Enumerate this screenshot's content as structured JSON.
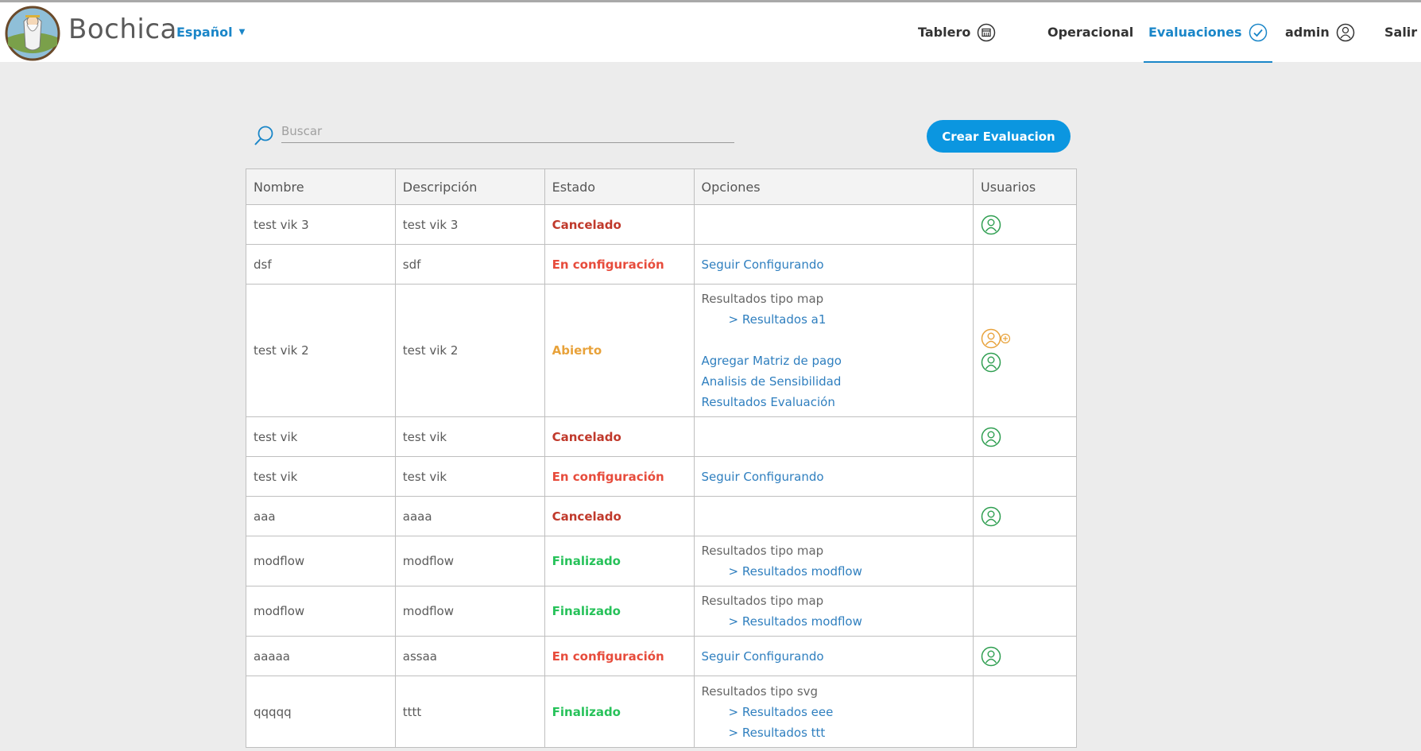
{
  "header": {
    "brand": "Bochica",
    "language": "Español",
    "nav": {
      "tablero": "Tablero",
      "operacional": "Operacional",
      "evaluaciones": "Evaluaciones",
      "admin": "admin",
      "salir": "Salir"
    }
  },
  "search": {
    "placeholder": "Buscar"
  },
  "create_button": "Crear Evaluacion",
  "table": {
    "headers": [
      "Nombre",
      "Descripción",
      "Estado",
      "Opciones",
      "Usuarios"
    ],
    "rows": [
      {
        "nombre": "test vik 3",
        "descripcion": "test vik 3",
        "estado": "Cancelado"
      },
      {
        "nombre": "dsf",
        "descripcion": "sdf",
        "estado": "En configuración",
        "opciones": {
          "link1": "Seguir Configurando"
        }
      },
      {
        "nombre": "test vik 2",
        "descripcion": "test vik 2",
        "estado": "Abierto",
        "opciones": {
          "head": "Resultados tipo map",
          "sub1": "> Resultados a1",
          "link1": "Agregar Matriz de pago",
          "link2": "Analisis de Sensibilidad",
          "link3": "Resultados Evaluación"
        }
      },
      {
        "nombre": "test vik",
        "descripcion": "test vik",
        "estado": "Cancelado"
      },
      {
        "nombre": "test vik",
        "descripcion": "test vik",
        "estado": "En configuración",
        "opciones": {
          "link1": "Seguir Configurando"
        }
      },
      {
        "nombre": "aaa",
        "descripcion": "aaaa",
        "estado": "Cancelado"
      },
      {
        "nombre": "modflow",
        "descripcion": "modflow",
        "estado": "Finalizado",
        "opciones": {
          "head": "Resultados tipo map",
          "sub1": "> Resultados modflow"
        }
      },
      {
        "nombre": "modflow",
        "descripcion": "modflow",
        "estado": "Finalizado",
        "opciones": {
          "head": "Resultados tipo map",
          "sub1": "> Resultados modflow"
        }
      },
      {
        "nombre": "aaaaa",
        "descripcion": "assaa",
        "estado": "En configuración",
        "opciones": {
          "link1": "Seguir Configurando"
        }
      },
      {
        "nombre": "qqqqq",
        "descripcion": "tttt",
        "estado": "Finalizado",
        "opciones": {
          "head": "Resultados tipo svg",
          "sub1": "> Resultados eee",
          "sub2": "> Resultados ttt"
        }
      }
    ]
  },
  "colors": {
    "accent": "#1a86c8",
    "button": "#0b96e0",
    "cancelado": "#c0392b",
    "en_configuracion": "#e74c3c",
    "abierto": "#e8a23a",
    "finalizado": "#27c25a",
    "user_icon": "#2e9e50",
    "user_add_icon": "#e8a23a"
  }
}
